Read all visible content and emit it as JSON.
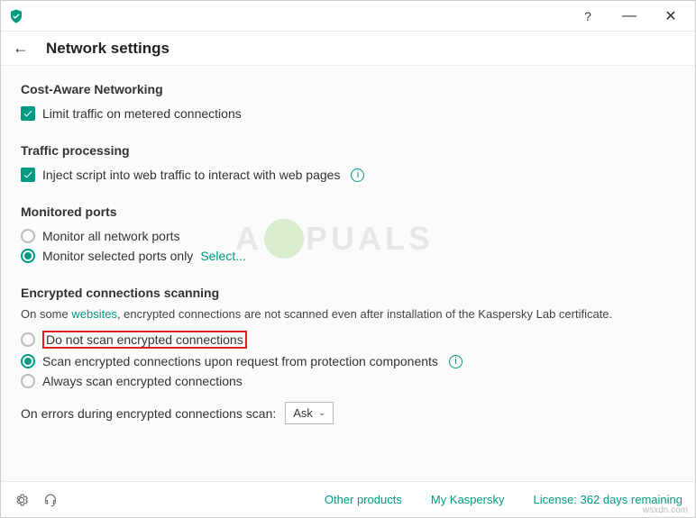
{
  "titlebar": {
    "help": "?",
    "minimize": "—",
    "close": "✕"
  },
  "header": {
    "back": "←",
    "title": "Network settings"
  },
  "sections": {
    "cost": {
      "title": "Cost-Aware Networking",
      "limit_label": "Limit traffic on metered connections"
    },
    "traffic": {
      "title": "Traffic processing",
      "inject_label": "Inject script into web traffic to interact with web pages"
    },
    "ports": {
      "title": "Monitored ports",
      "all_label": "Monitor all network ports",
      "selected_label": "Monitor selected ports only",
      "select_link": "Select..."
    },
    "encrypted": {
      "title": "Encrypted connections scanning",
      "desc_pre": "On some ",
      "desc_link": "websites",
      "desc_post": ", encrypted connections are not scanned even after installation of the Kaspersky Lab certificate.",
      "opt1": "Do not scan encrypted connections",
      "opt2": "Scan encrypted connections upon request from protection components",
      "opt3": "Always scan encrypted connections",
      "on_errors_label": "On errors during encrypted connections scan:",
      "on_errors_value": "Ask"
    }
  },
  "footer": {
    "other": "Other products",
    "my": "My Kaspersky",
    "license": "License: 362 days remaining"
  },
  "watermark": {
    "pre": "A",
    "post": "PUALS",
    "domain": "wsxdn.com"
  }
}
